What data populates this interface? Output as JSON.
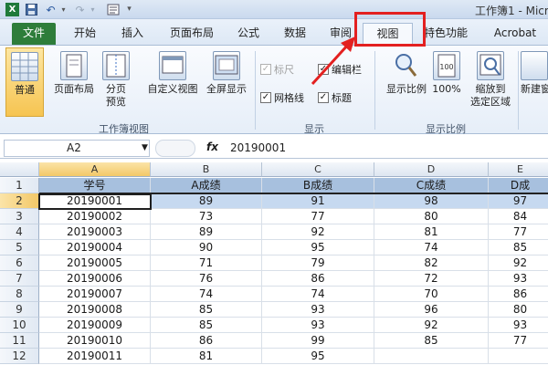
{
  "quick_access": {
    "app_icon": "excel-x-icon",
    "save_icon": "save-icon",
    "undo_icon": "undo-icon",
    "redo_icon": "redo-icon",
    "print_icon": "print-preview-icon"
  },
  "window": {
    "title": "工作簿1 - Micr"
  },
  "tabs": [
    {
      "id": "file",
      "label": "文件"
    },
    {
      "id": "home",
      "label": "开始"
    },
    {
      "id": "insert",
      "label": "插入"
    },
    {
      "id": "layout",
      "label": "页面布局"
    },
    {
      "id": "formula",
      "label": "公式"
    },
    {
      "id": "data",
      "label": "数据"
    },
    {
      "id": "review",
      "label": "审阅"
    },
    {
      "id": "view",
      "label": "视图"
    },
    {
      "id": "special",
      "label": "特色功能"
    },
    {
      "id": "acrobat",
      "label": "Acrobat"
    }
  ],
  "ribbon": {
    "workbook_views": {
      "group_label": "工作簿视图",
      "normal": "普通",
      "page_layout": "页面布局",
      "page_break_1": "分页",
      "page_break_2": "预览",
      "custom_view": "自定义视图",
      "full_screen": "全屏显示"
    },
    "show": {
      "group_label": "显示",
      "ruler": "标尺",
      "formula_bar": "编辑栏",
      "gridlines": "网格线",
      "headings": "标题"
    },
    "zoom": {
      "group_label": "显示比例",
      "zoom": "显示比例",
      "hundred": "100%",
      "zoom_sel_1": "缩放到",
      "zoom_sel_2": "选定区域",
      "new_window": "新建窗"
    }
  },
  "formula_bar": {
    "name_box": "A2",
    "fx": "fx",
    "value": "20190001"
  },
  "grid": {
    "columns": [
      "A",
      "B",
      "C",
      "D",
      "E"
    ],
    "row_numbers": [
      "1",
      "2",
      "3",
      "4",
      "5",
      "6",
      "7",
      "8",
      "9",
      "10",
      "11",
      "12"
    ],
    "headers": [
      "学号",
      "A成绩",
      "B成绩",
      "C成绩",
      "D成"
    ],
    "rows": [
      [
        "20190001",
        "89",
        "91",
        "98",
        "97"
      ],
      [
        "20190002",
        "73",
        "77",
        "80",
        "84"
      ],
      [
        "20190003",
        "89",
        "92",
        "81",
        "77"
      ],
      [
        "20190004",
        "90",
        "95",
        "74",
        "85"
      ],
      [
        "20190005",
        "71",
        "79",
        "82",
        "92"
      ],
      [
        "20190006",
        "76",
        "86",
        "72",
        "93"
      ],
      [
        "20190007",
        "74",
        "74",
        "70",
        "86"
      ],
      [
        "20190008",
        "85",
        "93",
        "96",
        "80"
      ],
      [
        "20190009",
        "85",
        "93",
        "92",
        "93"
      ],
      [
        "20190010",
        "86",
        "99",
        "85",
        "77"
      ],
      [
        "20190011",
        "81",
        "95",
        "",
        ""
      ]
    ]
  },
  "colors": {
    "file_tab": "#2e7d3a",
    "highlight": "#e32020",
    "header_fill": "#a7c0de",
    "selection_fill": "#c6d9f0"
  }
}
